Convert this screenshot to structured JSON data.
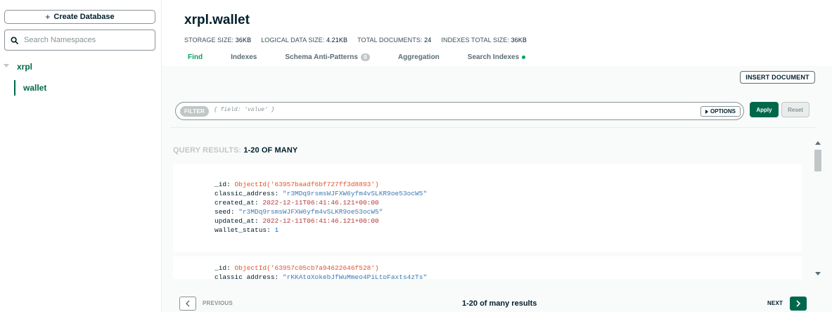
{
  "sidebar": {
    "create_database_label": "Create Database",
    "search_placeholder": "Search Namespaces",
    "database": "xrpl",
    "collection": "wallet"
  },
  "header": {
    "title": "xrpl.wallet",
    "stats": [
      {
        "label": "STORAGE SIZE:",
        "value": "36KB"
      },
      {
        "label": "LOGICAL DATA SIZE:",
        "value": "4.21KB"
      },
      {
        "label": "TOTAL DOCUMENTS:",
        "value": "24"
      },
      {
        "label": "INDEXES TOTAL SIZE:",
        "value": "36KB"
      }
    ],
    "tabs": [
      {
        "label": "Find",
        "active": true
      },
      {
        "label": "Indexes"
      },
      {
        "label": "Schema Anti-Patterns",
        "badge": "0"
      },
      {
        "label": "Aggregation"
      },
      {
        "label": "Search Indexes",
        "dot": true
      }
    ]
  },
  "toolbar": {
    "insert_document_label": "INSERT DOCUMENT",
    "filter_label": "FILTER",
    "filter_placeholder": "{ field: 'value' }",
    "options_label": "OPTIONS",
    "apply_label": "Apply",
    "reset_label": "Reset"
  },
  "results": {
    "label_prefix": "QUERY RESULTS:",
    "label_range": "1-20 OF MANY",
    "documents": [
      {
        "fields": [
          {
            "key": "_id",
            "value": "ObjectId('63957baadf6bf727ff3d8893')",
            "type": "oid"
          },
          {
            "key": "classic_address",
            "value": "\"r3MDq9rsmsWJFXW6yfm4vSLKR9oe53ocW5\"",
            "type": "str"
          },
          {
            "key": "created_at",
            "value": "2022-12-11T06:41:46.121+00:00",
            "type": "date"
          },
          {
            "key": "seed",
            "value": "\"r3MDq9rsmsWJFXW6yfm4vSLKR9oe53ocW5\"",
            "type": "str"
          },
          {
            "key": "updated_at",
            "value": "2022-12-11T06:41:46.121+00:00",
            "type": "date"
          },
          {
            "key": "wallet_status",
            "value": "1",
            "type": "num"
          }
        ]
      },
      {
        "fields": [
          {
            "key": "_id",
            "value": "ObjectId('63957c05cb7a94622646f528')",
            "type": "oid"
          },
          {
            "key": "classic_address",
            "value": "\"rKKAtgXokebJfWuMmeo4PiLtpFaxts4zTs\"",
            "type": "str"
          }
        ]
      }
    ]
  },
  "pagination": {
    "previous_label": "PREVIOUS",
    "summary": "1-20 of many results",
    "next_label": "NEXT"
  },
  "colors": {
    "accent": "#00684a",
    "active_tab": "#00a35c"
  }
}
